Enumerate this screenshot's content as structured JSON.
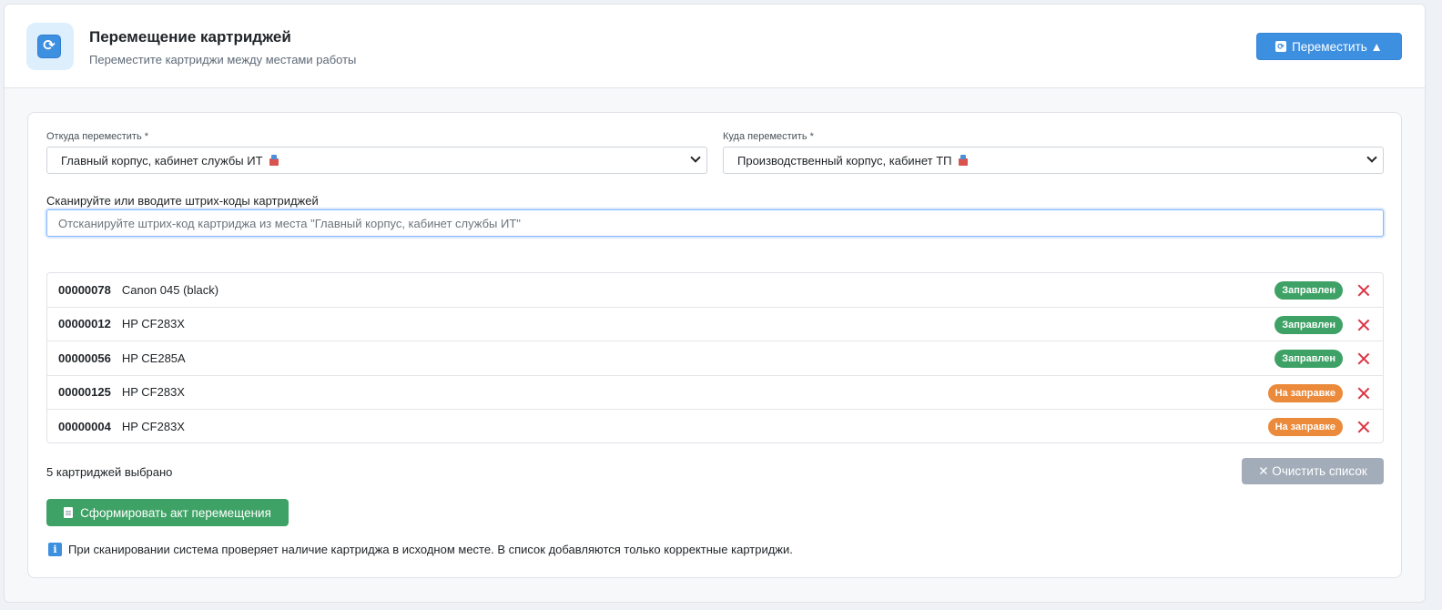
{
  "header": {
    "title": "Перемещение картриджей",
    "subtitle": "Переместите картриджи между местами работы",
    "move_button_label": "Переместить ▲"
  },
  "form": {
    "from_label": "Откуда переместить *",
    "from_value": "Главный корпус, кабинет службы ИТ",
    "to_label": "Куда переместить *",
    "to_value": "Производственный корпус, кабинет ТП",
    "scan_label": "Сканируйте или вводите штрих-коды картриджей",
    "scan_placeholder": "Отсканируйте штрих-код картриджа из места \"Главный корпус, кабинет службы ИТ\""
  },
  "cartridges": [
    {
      "code": "00000078",
      "model": "Canon 045 (black)",
      "status": "Заправлен",
      "status_type": "ok"
    },
    {
      "code": "00000012",
      "model": "HP CF283X",
      "status": "Заправлен",
      "status_type": "ok"
    },
    {
      "code": "00000056",
      "model": "HP CE285A",
      "status": "Заправлен",
      "status_type": "ok"
    },
    {
      "code": "00000125",
      "model": "HP CF283X",
      "status": "На заправке",
      "status_type": "refill"
    },
    {
      "code": "00000004",
      "model": "HP CF283X",
      "status": "На заправке",
      "status_type": "refill"
    }
  ],
  "footer": {
    "count_text": "5 картриджей выбрано",
    "clear_button_label": "✕ Очистить список",
    "act_button_label": "Сформировать акт перемещения",
    "info_text": "При сканировании система проверяет наличие картриджа в исходном месте. В список добавляются только корректные картриджи."
  },
  "colors": {
    "accent": "#3d8fe0",
    "success": "#3ea266",
    "warning": "#ea8a3a",
    "danger": "#dc3545",
    "disabled": "#a3adba"
  },
  "icons": {
    "app": "refresh-icon",
    "move": "refresh-icon",
    "location": "building-icon",
    "remove": "close-icon",
    "document": "document-icon",
    "info": "info-icon"
  }
}
